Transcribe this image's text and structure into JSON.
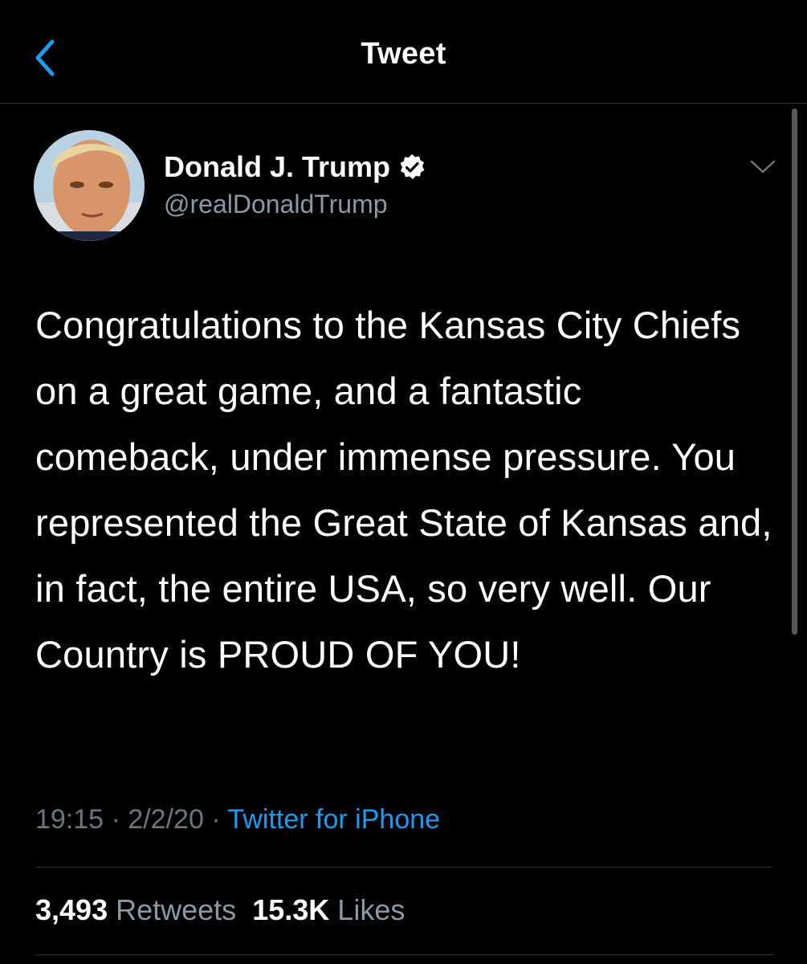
{
  "nav": {
    "title": "Tweet",
    "back_icon": "chevron-left-icon"
  },
  "author": {
    "display_name": "Donald J. Trump",
    "handle": "@realDonaldTrump",
    "verified": true
  },
  "tweet": {
    "text": "Congratulations to the Kansas City Chiefs on a great game, and a fantastic comeback, under immense pressure. You represented the Great State of Kansas and, in fact, the entire USA, so very well. Our Country is PROUD OF YOU!",
    "time": "19:15",
    "separator": "·",
    "date": "2/2/20",
    "source": "Twitter for iPhone"
  },
  "stats": {
    "retweets_count": "3,493",
    "retweets_label": "Retweets",
    "likes_count": "15.3K",
    "likes_label": "Likes"
  },
  "colors": {
    "background": "#000000",
    "accent": "#1d9bf0",
    "secondary_text": "#8b98a5",
    "divider": "#2f3336"
  }
}
